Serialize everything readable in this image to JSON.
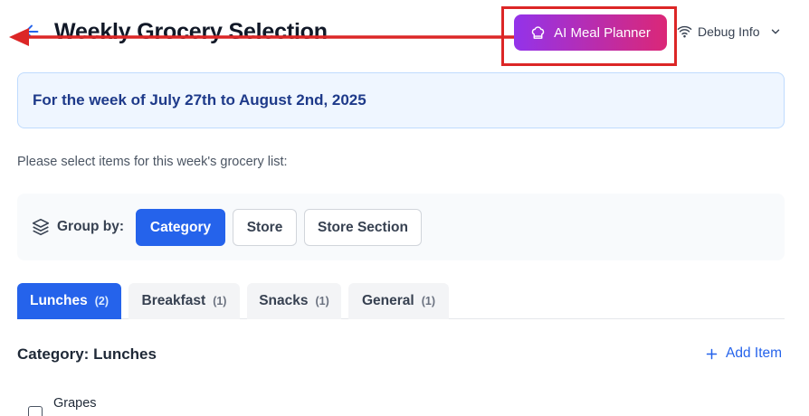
{
  "header": {
    "title": "Weekly Grocery Selection",
    "back_icon": "back-arrow-icon",
    "ai_button_label": "AI Meal Planner",
    "ai_button_icon": "chef-hat-icon",
    "debug_label": "Debug Info",
    "debug_icon": "wifi-icon",
    "debug_chevron_icon": "chevron-down-icon"
  },
  "banner": {
    "text": "For the week of July 27th to August 2nd, 2025"
  },
  "instruction": "Please select items for this week's grocery list:",
  "group_by": {
    "label": "Group by:",
    "icon": "layers-icon",
    "options": [
      {
        "label": "Category",
        "active": true
      },
      {
        "label": "Store",
        "active": false
      },
      {
        "label": "Store Section",
        "active": false
      }
    ]
  },
  "tabs": [
    {
      "label": "Lunches",
      "count": "(2)",
      "active": true
    },
    {
      "label": "Breakfast",
      "count": "(1)",
      "active": false
    },
    {
      "label": "Snacks",
      "count": "(1)",
      "active": false
    },
    {
      "label": "General",
      "count": "(1)",
      "active": false
    }
  ],
  "category": {
    "title": "Category: Lunches",
    "add_item_label": "Add Item",
    "add_item_icon": "plus-icon"
  },
  "items": [
    {
      "name": "Grapes",
      "checked": false
    }
  ],
  "colors": {
    "primary": "#2563eb",
    "ai_gradient_start": "#9333ea",
    "ai_gradient_end": "#db2777",
    "annotation": "#dc2626",
    "banner_bg": "#eff6ff",
    "banner_text": "#1e3a8a"
  }
}
